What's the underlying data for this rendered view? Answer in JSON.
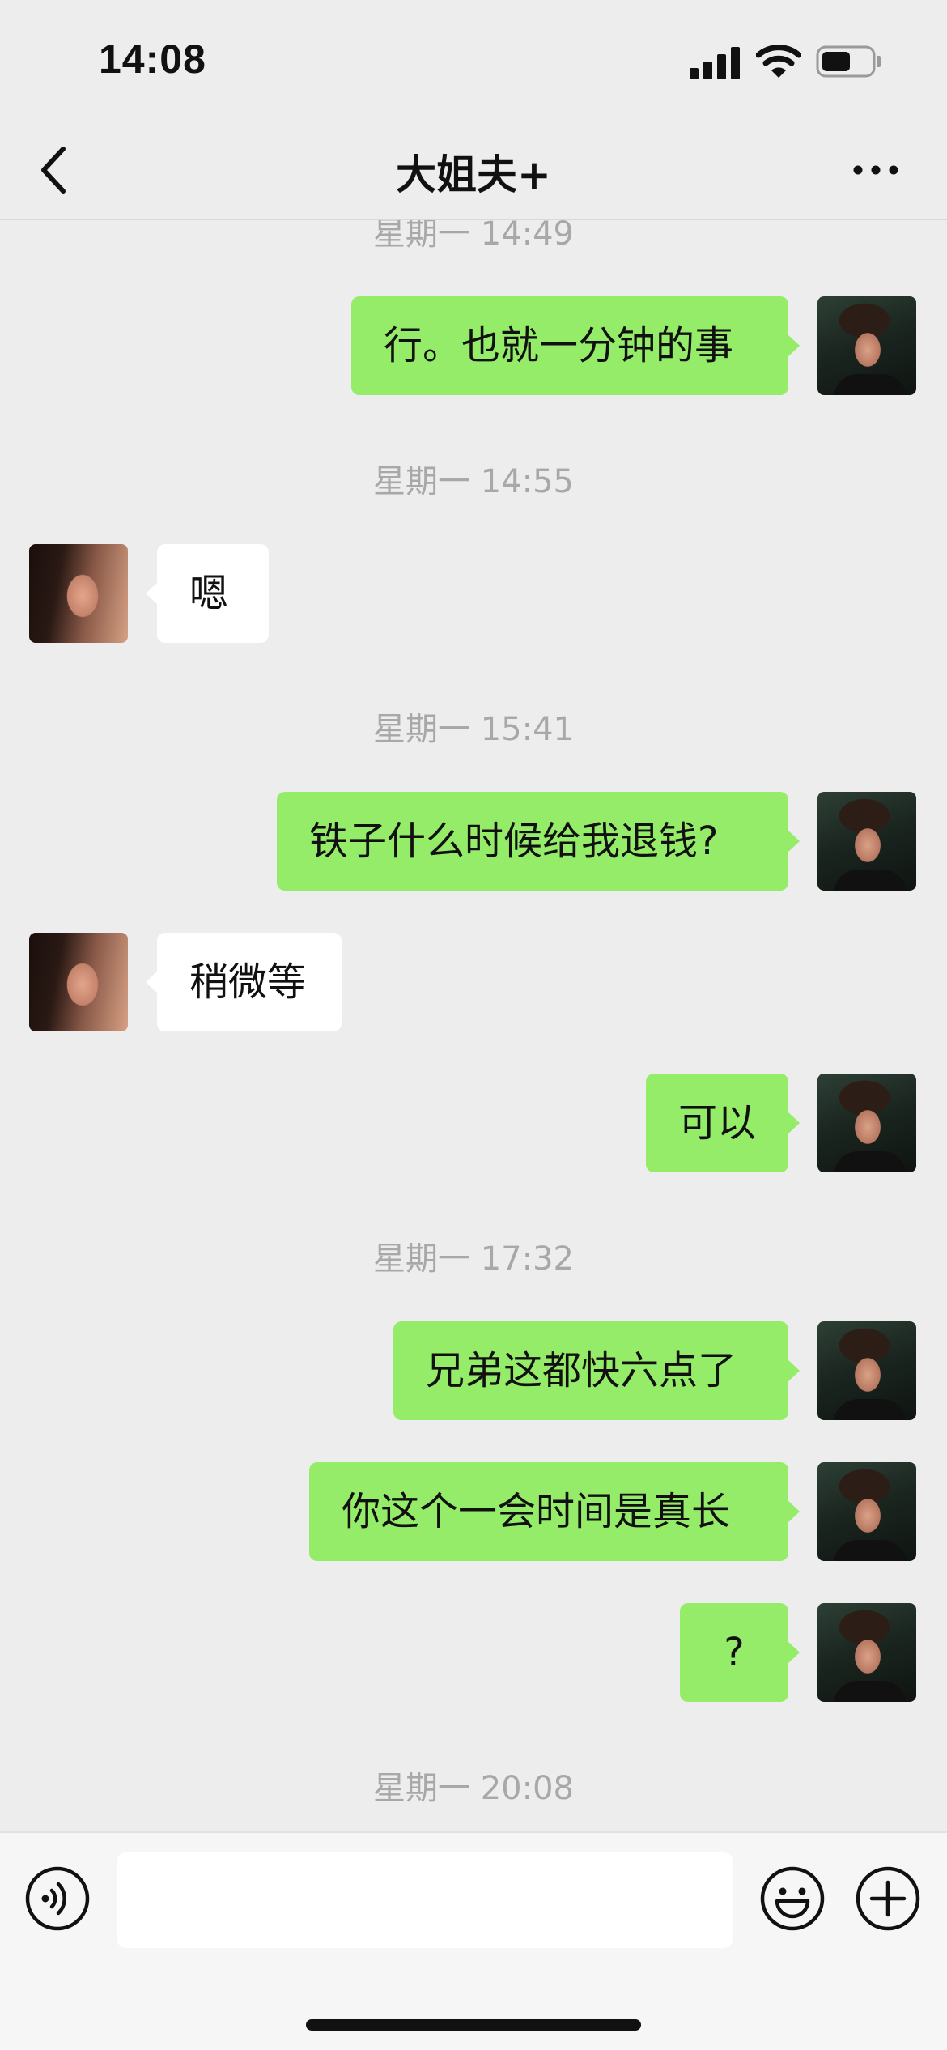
{
  "status_bar": {
    "time": "14:08"
  },
  "header": {
    "title": "大姐夫+"
  },
  "messages": [
    {
      "type": "timestamp",
      "text": "星期一 14:49"
    },
    {
      "type": "sent",
      "text": "行。也就一分钟的事"
    },
    {
      "type": "timestamp",
      "text": "星期一 14:55"
    },
    {
      "type": "received",
      "text": "嗯"
    },
    {
      "type": "timestamp",
      "text": "星期一 15:41"
    },
    {
      "type": "sent",
      "text": "铁子什么时候给我退钱?"
    },
    {
      "type": "received",
      "text": "稍微等"
    },
    {
      "type": "sent",
      "text": "可以"
    },
    {
      "type": "timestamp",
      "text": "星期一 17:32"
    },
    {
      "type": "sent",
      "text": "兄弟这都快六点了"
    },
    {
      "type": "sent",
      "text": "你这个一会时间是真长"
    },
    {
      "type": "sent",
      "text": "?"
    },
    {
      "type": "timestamp",
      "text": "星期一 20:08"
    }
  ],
  "input_bar": {
    "value": ""
  },
  "colors": {
    "sent_bubble": "#95ec69",
    "received_bubble": "#ffffff",
    "background": "#ededed"
  },
  "icons": {
    "back": "chevron-left-icon",
    "more": "more-dots-icon",
    "voice": "voice-icon",
    "emoji": "emoji-icon",
    "plus": "plus-icon"
  }
}
